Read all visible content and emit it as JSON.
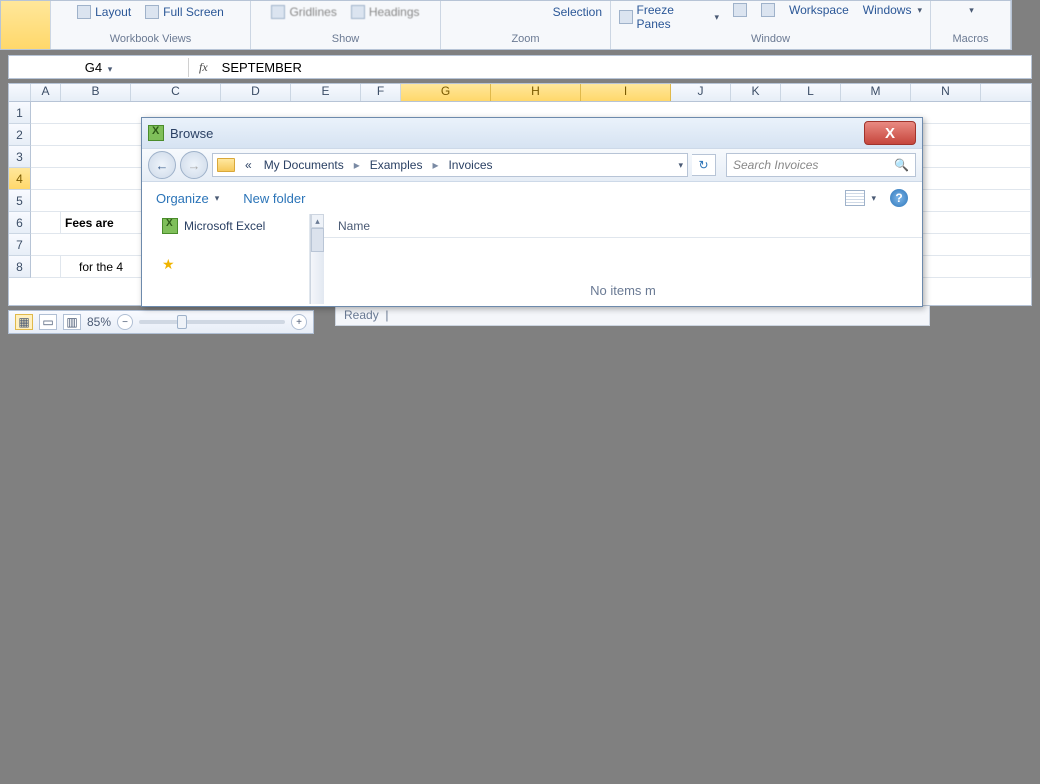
{
  "ribbon": {
    "groups": {
      "views": {
        "label": "Workbook Views",
        "layout": "Layout",
        "fullscreen": "Full Screen"
      },
      "show": {
        "label": "Show",
        "gridlines": "Gridlines",
        "headings": "Headings"
      },
      "zoom": {
        "label": "Zoom",
        "selection": "Selection"
      },
      "window": {
        "label": "Window",
        "freeze": "Freeze Panes",
        "workspace": "Workspace",
        "windows": "Windows"
      },
      "macros": {
        "label": "Macros"
      }
    }
  },
  "formula_bar": {
    "name_box": "G4",
    "fx": "fx",
    "value": "SEPTEMBER"
  },
  "columns": [
    "A",
    "B",
    "C",
    "D",
    "E",
    "F",
    "G",
    "H",
    "I",
    "J",
    "K",
    "L",
    "M",
    "N"
  ],
  "selected_cols": [
    "G",
    "H",
    "I"
  ],
  "row_count": 8,
  "selected_row": 4,
  "cells": {
    "r6_b": "Fees are",
    "r8_b": "for the 4"
  },
  "status": {
    "zoom": "85%",
    "ready": "Ready"
  },
  "dialog": {
    "title": "Browse",
    "close_glyph": "X",
    "breadcrumb": {
      "prefix": "«",
      "items": [
        "My Documents",
        "Examples",
        "Invoices"
      ]
    },
    "search_placeholder": "Search Invoices",
    "toolbar": {
      "organize": "Organize",
      "newfolder": "New folder"
    },
    "side": {
      "item1": "Microsoft Excel"
    },
    "list": {
      "col_name": "Name",
      "empty": "No items m"
    }
  }
}
